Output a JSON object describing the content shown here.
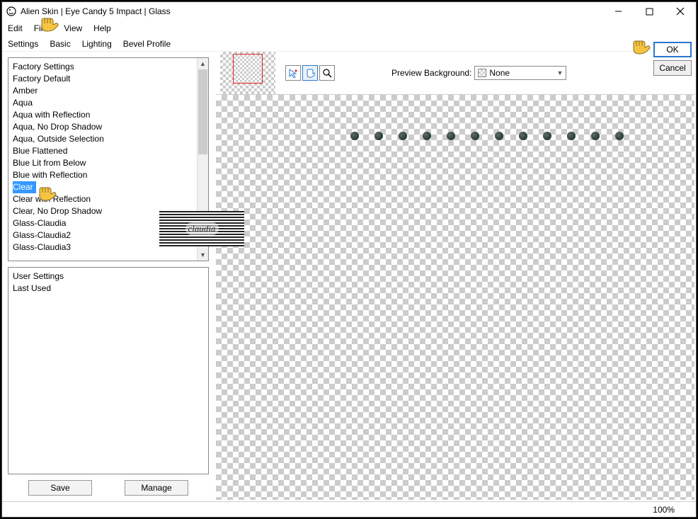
{
  "window": {
    "title": "Alien Skin | Eye Candy 5 Impact | Glass"
  },
  "menubar": [
    "Edit",
    "Filter",
    "View",
    "Help"
  ],
  "tabs": [
    "Settings",
    "Basic",
    "Lighting",
    "Bevel Profile"
  ],
  "factory_list": {
    "header": "Factory Settings",
    "items": [
      "Factory Default",
      "Amber",
      "Aqua",
      "Aqua with Reflection",
      "Aqua, No Drop Shadow",
      "Aqua, Outside Selection",
      "Blue Flattened",
      "Blue Lit from Below",
      "Blue with Reflection",
      "Clear",
      "Clear with Reflection",
      "Clear, No Drop Shadow",
      "Glass-Claudia",
      "Glass-Claudia2",
      "Glass-Claudia3"
    ],
    "selected_index": 9
  },
  "user_list": {
    "header": "User Settings",
    "items": [
      "Last Used"
    ]
  },
  "buttons": {
    "save": "Save",
    "manage": "Manage",
    "ok": "OK",
    "cancel": "Cancel"
  },
  "preview": {
    "bg_label": "Preview Background:",
    "bg_value": "None"
  },
  "status": {
    "zoom": "100%"
  },
  "watermark": "claudia"
}
